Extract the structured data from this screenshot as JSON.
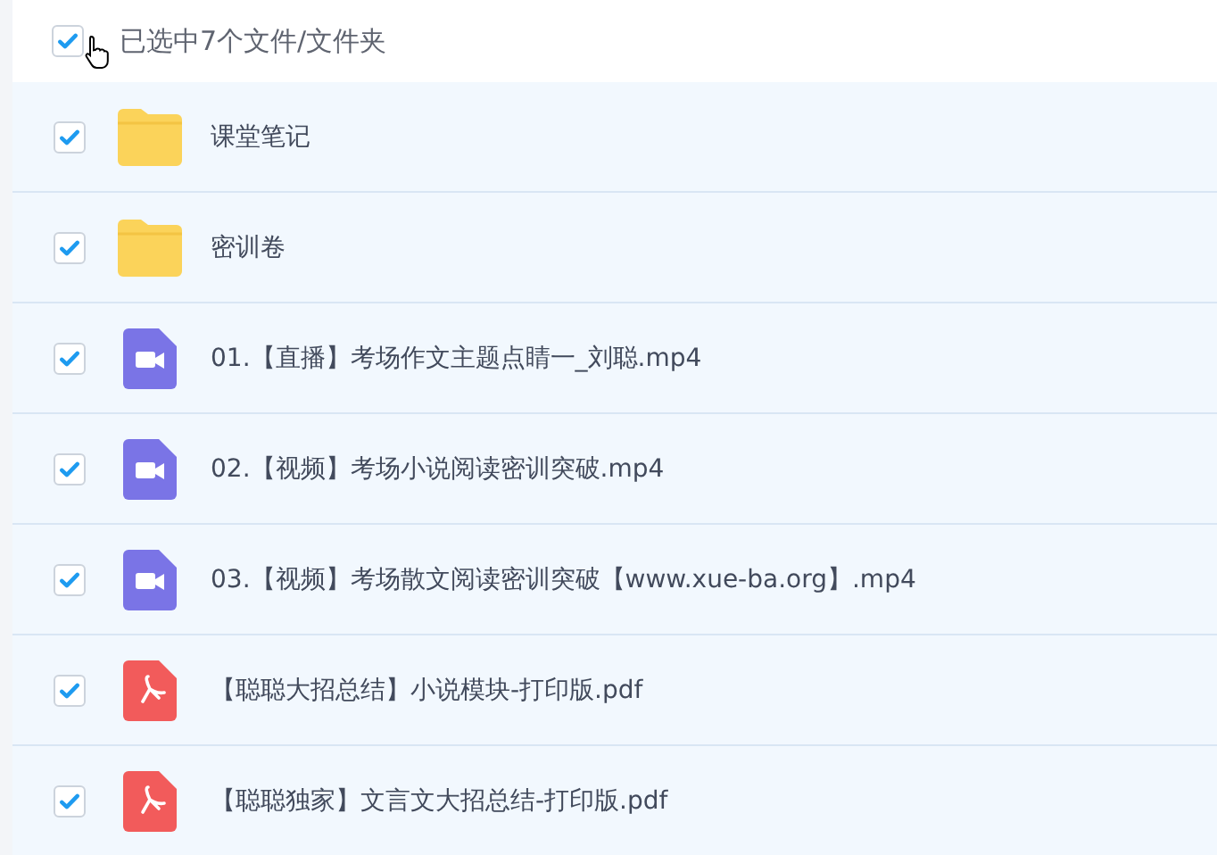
{
  "header": {
    "checked": true,
    "label": "已选中7个文件/文件夹"
  },
  "files": [
    {
      "kind": "folder",
      "name": "课堂笔记",
      "checked": true
    },
    {
      "kind": "folder",
      "name": "密训卷",
      "checked": true
    },
    {
      "kind": "video",
      "name": "01.【直播】考场作文主题点睛一_刘聪.mp4",
      "checked": true
    },
    {
      "kind": "video",
      "name": "02.【视频】考场小说阅读密训突破.mp4",
      "checked": true
    },
    {
      "kind": "video",
      "name": "03.【视频】考场散文阅读密训突破【www.xue-ba.org】.mp4",
      "checked": true
    },
    {
      "kind": "pdf",
      "name": "【聪聪大招总结】小说模块-打印版.pdf",
      "checked": true
    },
    {
      "kind": "pdf",
      "name": "【聪聪独家】文言文大招总结-打印版.pdf",
      "checked": true
    }
  ]
}
